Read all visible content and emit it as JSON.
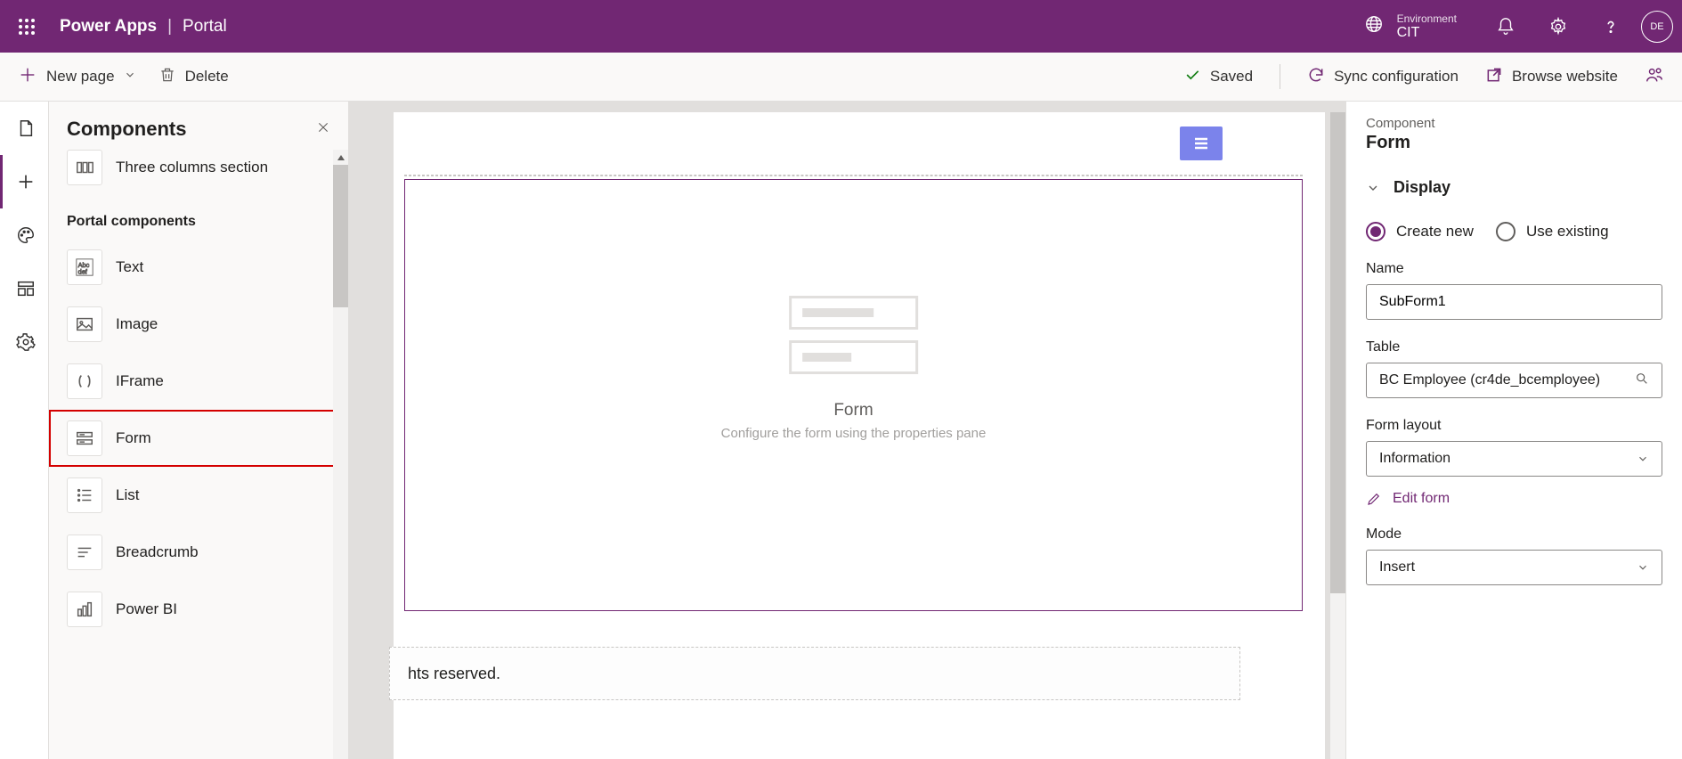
{
  "header": {
    "product": "Power Apps",
    "section": "Portal",
    "environment_label": "Environment",
    "environment_name": "CIT",
    "avatar_initials": "DE"
  },
  "commandbar": {
    "new_page": "New page",
    "delete": "Delete",
    "saved": "Saved",
    "sync": "Sync configuration",
    "browse": "Browse website"
  },
  "components_panel": {
    "title": "Components",
    "three_cols": "Three columns section",
    "group_title": "Portal components",
    "items": {
      "text": "Text",
      "image": "Image",
      "iframe": "IFrame",
      "form": "Form",
      "list": "List",
      "breadcrumb": "Breadcrumb",
      "powerbi": "Power BI"
    }
  },
  "canvas": {
    "form_title": "Form",
    "form_subtitle": "Configure the form using the properties pane",
    "footer_text": "hts reserved."
  },
  "right_panel": {
    "component_label": "Component",
    "component_type": "Form",
    "section_display": "Display",
    "radio_create": "Create new",
    "radio_existing": "Use existing",
    "name_label": "Name",
    "name_value": "SubForm1",
    "table_label": "Table",
    "table_value": "BC Employee (cr4de_bcemployee)",
    "layout_label": "Form layout",
    "layout_value": "Information",
    "edit_form": "Edit form",
    "mode_label": "Mode",
    "mode_value": "Insert"
  }
}
